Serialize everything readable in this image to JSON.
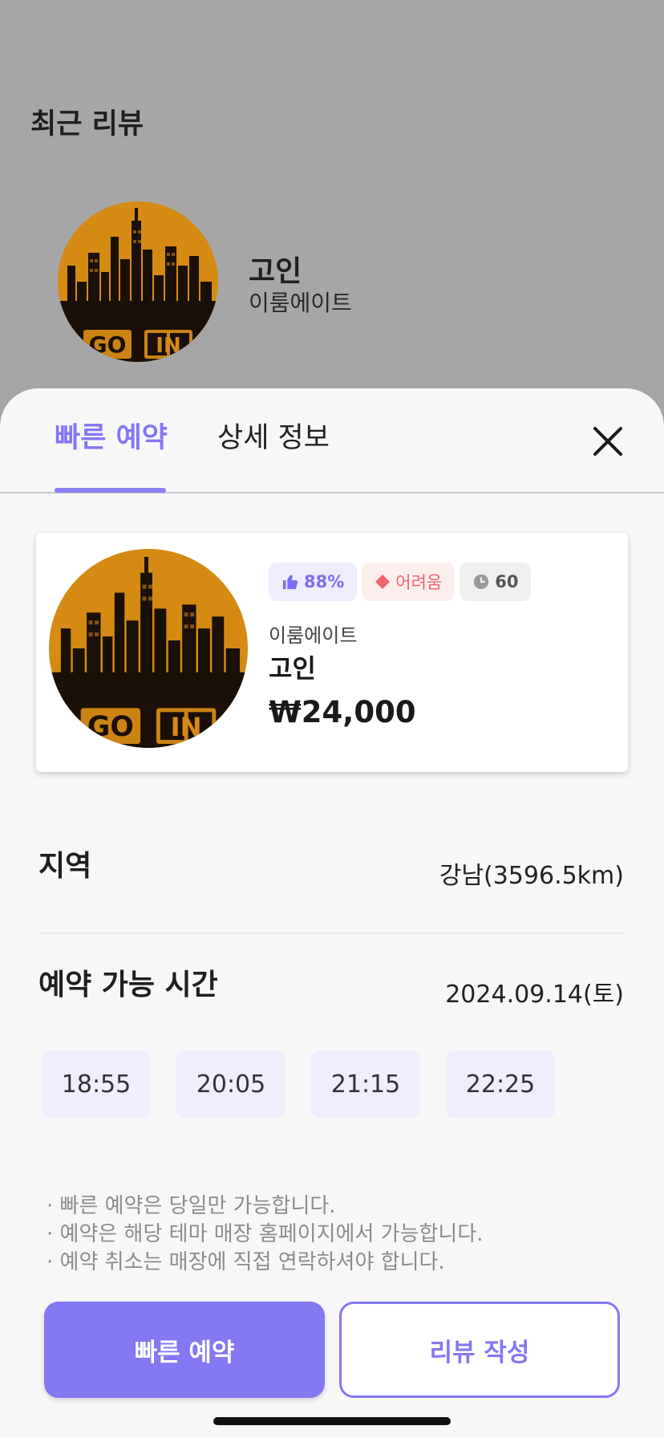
{
  "background": {
    "section_title": "최근 리뷰",
    "review": {
      "name": "고인",
      "shop": "이룸에이트",
      "logo_text": [
        "GO",
        "IN"
      ]
    }
  },
  "sheet": {
    "tabs": [
      {
        "label": "빠른 예약",
        "active": true
      },
      {
        "label": "상세 정보",
        "active": false
      }
    ],
    "close_icon": "close-icon",
    "card": {
      "logo_text": [
        "GO",
        "IN"
      ],
      "badges": {
        "like": {
          "icon": "thumbs-up-icon",
          "text": "88%"
        },
        "difficulty": {
          "icon": "diamond-icon",
          "text": "어려움"
        },
        "time": {
          "icon": "clock-icon",
          "text": "60"
        }
      },
      "shop": "이룸에이트",
      "name": "고인",
      "price": "₩24,000"
    },
    "region": {
      "label": "지역",
      "value": "강남(3596.5km)"
    },
    "availability": {
      "label": "예약 가능 시간",
      "date": "2024.09.14(토)",
      "slots": [
        "18:55",
        "20:05",
        "21:15",
        "22:25"
      ]
    },
    "notes": [
      "· 빠른 예약은 당일만 가능합니다.",
      "· 예약은 해당 테마 매장 홈페이지에서 가능합니다.",
      "· 예약 취소는 매장에 직접 연락하셔야 합니다."
    ],
    "buttons": {
      "primary": "빠른 예약",
      "secondary": "리뷰 작성"
    }
  },
  "colors": {
    "accent": "#8478f3",
    "overlay": "#a6a6a6",
    "difficulty": "#f0636d",
    "slot_bg": "#efeefd"
  }
}
